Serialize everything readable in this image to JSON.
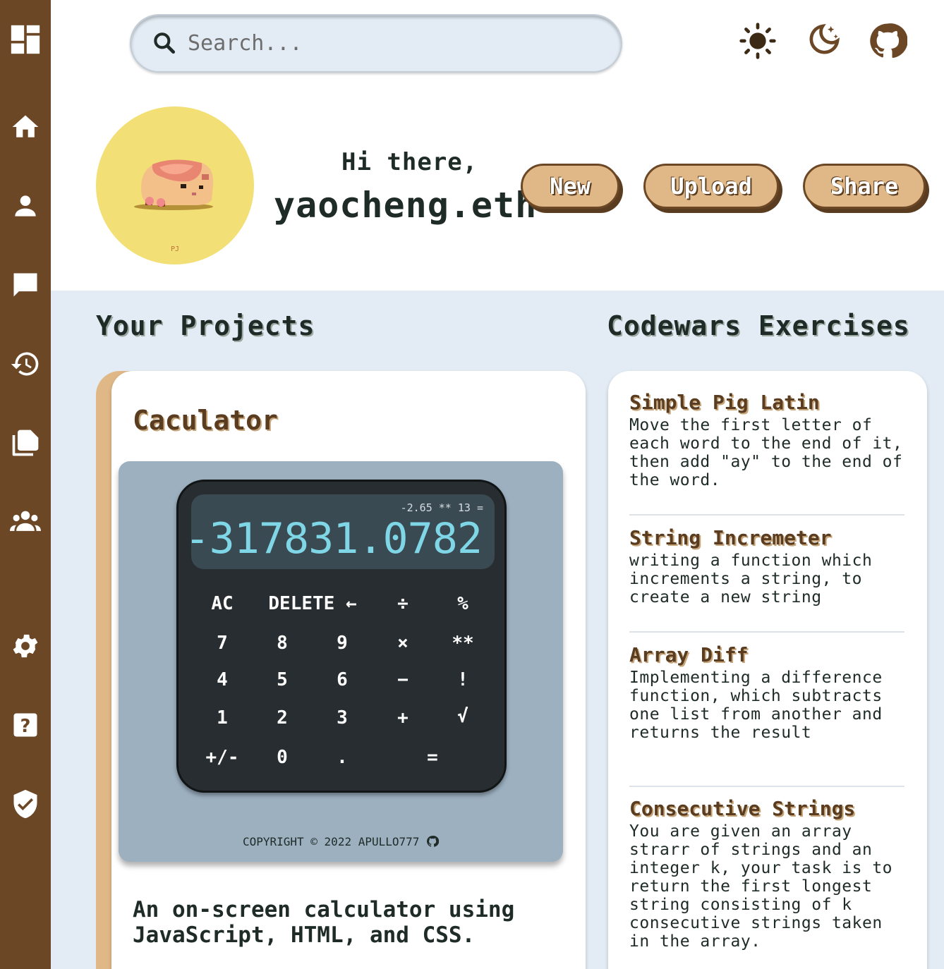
{
  "search": {
    "placeholder": "Search..."
  },
  "icons": {
    "sidebar": [
      "dashboard-icon",
      "home-icon",
      "profile-icon",
      "messages-icon",
      "history-icon",
      "documents-icon",
      "community-icon",
      "settings-icon",
      "help-icon",
      "verified-icon"
    ],
    "header": [
      "sun-icon",
      "moon-icon",
      "github-icon"
    ]
  },
  "profile": {
    "greeting": "Hi there,",
    "username": "yaocheng.eth"
  },
  "actions": {
    "new_label": "New",
    "upload_label": "Upload",
    "share_label": "Share"
  },
  "projects": {
    "heading": "Your Projects",
    "card": {
      "title": "Caculator",
      "calculator": {
        "previous": "-2.65 ** 13 =",
        "current": "-317831.0782",
        "keys": [
          "AC",
          "DELETE ←",
          "÷",
          "%",
          "7",
          "8",
          "9",
          "×",
          "**",
          "4",
          "5",
          "6",
          "−",
          "!",
          "1",
          "2",
          "3",
          "+",
          "√",
          "+/-",
          "0",
          ".",
          "="
        ],
        "copyright": "COPYRIGHT © 2022 APULLO777"
      },
      "description": "An on-screen calculator using JavaScript, HTML, and CSS."
    }
  },
  "codewars": {
    "heading": "Codewars Exercises",
    "items": [
      {
        "title": "Simple Pig Latin",
        "desc": "Move the first letter of each word to the end of it, then add \"ay\" to the end of the word."
      },
      {
        "title": "String Incremeter",
        "desc": "writing a function which increments a string, to create a new string"
      },
      {
        "title": "Array Diff",
        "desc": "Implementing a difference function, which subtracts one list from another and returns the result"
      },
      {
        "title": "Consecutive Strings",
        "desc": "You are given an array strarr of strings and an integer k, your task is to return the first longest string consisting of k consecutive strings taken in the array."
      }
    ]
  },
  "colors": {
    "sidebar": "#6b4726",
    "accent": "#e0b887",
    "background": "#e3ecf5",
    "avatar_bg": "#f2df75",
    "display_text": "#7fd6e6"
  }
}
